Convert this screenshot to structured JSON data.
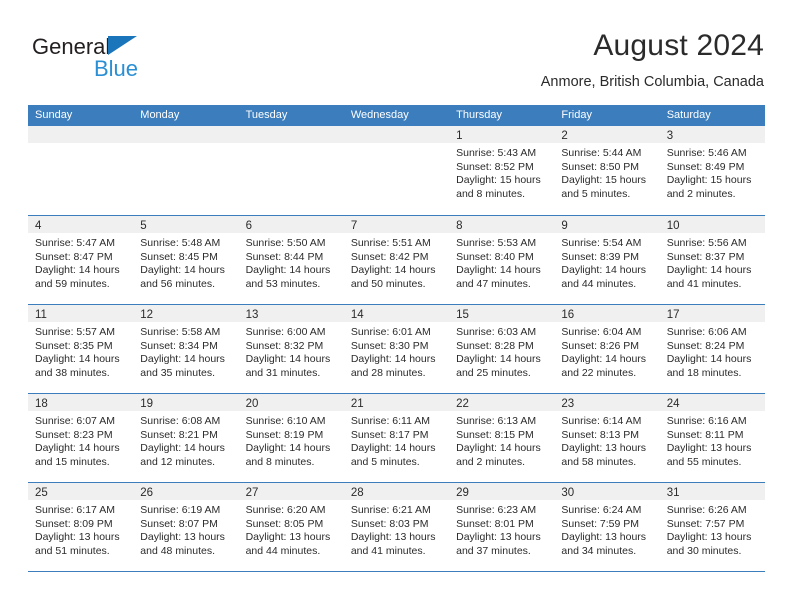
{
  "brand": {
    "name_part1": "General",
    "name_part2": "Blue",
    "triangle_color": "#1b75bb",
    "blue_text_color": "#2a8fd4"
  },
  "header": {
    "title": "August 2024",
    "subtitle": "Anmore, British Columbia, Canada"
  },
  "theme": {
    "header_blue": "#3b7dbd",
    "date_strip_gray": "#f0f0f0",
    "text_color": "#2b2b2b"
  },
  "weekdays": [
    "Sunday",
    "Monday",
    "Tuesday",
    "Wednesday",
    "Thursday",
    "Friday",
    "Saturday"
  ],
  "weeks": [
    [
      {
        "day": "",
        "lines": [
          "",
          "",
          "",
          ""
        ]
      },
      {
        "day": "",
        "lines": [
          "",
          "",
          "",
          ""
        ]
      },
      {
        "day": "",
        "lines": [
          "",
          "",
          "",
          ""
        ]
      },
      {
        "day": "",
        "lines": [
          "",
          "",
          "",
          ""
        ]
      },
      {
        "day": "1",
        "lines": [
          "Sunrise: 5:43 AM",
          "Sunset: 8:52 PM",
          "Daylight: 15 hours",
          "and 8 minutes."
        ]
      },
      {
        "day": "2",
        "lines": [
          "Sunrise: 5:44 AM",
          "Sunset: 8:50 PM",
          "Daylight: 15 hours",
          "and 5 minutes."
        ]
      },
      {
        "day": "3",
        "lines": [
          "Sunrise: 5:46 AM",
          "Sunset: 8:49 PM",
          "Daylight: 15 hours",
          "and 2 minutes."
        ]
      }
    ],
    [
      {
        "day": "4",
        "lines": [
          "Sunrise: 5:47 AM",
          "Sunset: 8:47 PM",
          "Daylight: 14 hours",
          "and 59 minutes."
        ]
      },
      {
        "day": "5",
        "lines": [
          "Sunrise: 5:48 AM",
          "Sunset: 8:45 PM",
          "Daylight: 14 hours",
          "and 56 minutes."
        ]
      },
      {
        "day": "6",
        "lines": [
          "Sunrise: 5:50 AM",
          "Sunset: 8:44 PM",
          "Daylight: 14 hours",
          "and 53 minutes."
        ]
      },
      {
        "day": "7",
        "lines": [
          "Sunrise: 5:51 AM",
          "Sunset: 8:42 PM",
          "Daylight: 14 hours",
          "and 50 minutes."
        ]
      },
      {
        "day": "8",
        "lines": [
          "Sunrise: 5:53 AM",
          "Sunset: 8:40 PM",
          "Daylight: 14 hours",
          "and 47 minutes."
        ]
      },
      {
        "day": "9",
        "lines": [
          "Sunrise: 5:54 AM",
          "Sunset: 8:39 PM",
          "Daylight: 14 hours",
          "and 44 minutes."
        ]
      },
      {
        "day": "10",
        "lines": [
          "Sunrise: 5:56 AM",
          "Sunset: 8:37 PM",
          "Daylight: 14 hours",
          "and 41 minutes."
        ]
      }
    ],
    [
      {
        "day": "11",
        "lines": [
          "Sunrise: 5:57 AM",
          "Sunset: 8:35 PM",
          "Daylight: 14 hours",
          "and 38 minutes."
        ]
      },
      {
        "day": "12",
        "lines": [
          "Sunrise: 5:58 AM",
          "Sunset: 8:34 PM",
          "Daylight: 14 hours",
          "and 35 minutes."
        ]
      },
      {
        "day": "13",
        "lines": [
          "Sunrise: 6:00 AM",
          "Sunset: 8:32 PM",
          "Daylight: 14 hours",
          "and 31 minutes."
        ]
      },
      {
        "day": "14",
        "lines": [
          "Sunrise: 6:01 AM",
          "Sunset: 8:30 PM",
          "Daylight: 14 hours",
          "and 28 minutes."
        ]
      },
      {
        "day": "15",
        "lines": [
          "Sunrise: 6:03 AM",
          "Sunset: 8:28 PM",
          "Daylight: 14 hours",
          "and 25 minutes."
        ]
      },
      {
        "day": "16",
        "lines": [
          "Sunrise: 6:04 AM",
          "Sunset: 8:26 PM",
          "Daylight: 14 hours",
          "and 22 minutes."
        ]
      },
      {
        "day": "17",
        "lines": [
          "Sunrise: 6:06 AM",
          "Sunset: 8:24 PM",
          "Daylight: 14 hours",
          "and 18 minutes."
        ]
      }
    ],
    [
      {
        "day": "18",
        "lines": [
          "Sunrise: 6:07 AM",
          "Sunset: 8:23 PM",
          "Daylight: 14 hours",
          "and 15 minutes."
        ]
      },
      {
        "day": "19",
        "lines": [
          "Sunrise: 6:08 AM",
          "Sunset: 8:21 PM",
          "Daylight: 14 hours",
          "and 12 minutes."
        ]
      },
      {
        "day": "20",
        "lines": [
          "Sunrise: 6:10 AM",
          "Sunset: 8:19 PM",
          "Daylight: 14 hours",
          "and 8 minutes."
        ]
      },
      {
        "day": "21",
        "lines": [
          "Sunrise: 6:11 AM",
          "Sunset: 8:17 PM",
          "Daylight: 14 hours",
          "and 5 minutes."
        ]
      },
      {
        "day": "22",
        "lines": [
          "Sunrise: 6:13 AM",
          "Sunset: 8:15 PM",
          "Daylight: 14 hours",
          "and 2 minutes."
        ]
      },
      {
        "day": "23",
        "lines": [
          "Sunrise: 6:14 AM",
          "Sunset: 8:13 PM",
          "Daylight: 13 hours",
          "and 58 minutes."
        ]
      },
      {
        "day": "24",
        "lines": [
          "Sunrise: 6:16 AM",
          "Sunset: 8:11 PM",
          "Daylight: 13 hours",
          "and 55 minutes."
        ]
      }
    ],
    [
      {
        "day": "25",
        "lines": [
          "Sunrise: 6:17 AM",
          "Sunset: 8:09 PM",
          "Daylight: 13 hours",
          "and 51 minutes."
        ]
      },
      {
        "day": "26",
        "lines": [
          "Sunrise: 6:19 AM",
          "Sunset: 8:07 PM",
          "Daylight: 13 hours",
          "and 48 minutes."
        ]
      },
      {
        "day": "27",
        "lines": [
          "Sunrise: 6:20 AM",
          "Sunset: 8:05 PM",
          "Daylight: 13 hours",
          "and 44 minutes."
        ]
      },
      {
        "day": "28",
        "lines": [
          "Sunrise: 6:21 AM",
          "Sunset: 8:03 PM",
          "Daylight: 13 hours",
          "and 41 minutes."
        ]
      },
      {
        "day": "29",
        "lines": [
          "Sunrise: 6:23 AM",
          "Sunset: 8:01 PM",
          "Daylight: 13 hours",
          "and 37 minutes."
        ]
      },
      {
        "day": "30",
        "lines": [
          "Sunrise: 6:24 AM",
          "Sunset: 7:59 PM",
          "Daylight: 13 hours",
          "and 34 minutes."
        ]
      },
      {
        "day": "31",
        "lines": [
          "Sunrise: 6:26 AM",
          "Sunset: 7:57 PM",
          "Daylight: 13 hours",
          "and 30 minutes."
        ]
      }
    ]
  ]
}
